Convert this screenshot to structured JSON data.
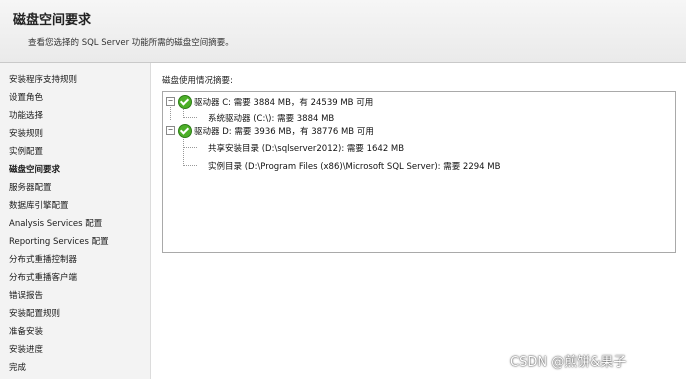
{
  "header": {
    "title": "磁盘空间要求",
    "subtitle": "查看您选择的 SQL Server 功能所需的磁盘空间摘要。"
  },
  "nav": {
    "items": [
      {
        "label": "安装程序支持规则"
      },
      {
        "label": "设置角色"
      },
      {
        "label": "功能选择"
      },
      {
        "label": "安装规则"
      },
      {
        "label": "实例配置"
      },
      {
        "label": "磁盘空间要求"
      },
      {
        "label": "服务器配置"
      },
      {
        "label": "数据库引擎配置"
      },
      {
        "label": "Analysis Services 配置"
      },
      {
        "label": "Reporting Services 配置"
      },
      {
        "label": "分布式重播控制器"
      },
      {
        "label": "分布式重播客户端"
      },
      {
        "label": "错误报告"
      },
      {
        "label": "安装配置规则"
      },
      {
        "label": "准备安装"
      },
      {
        "label": "安装进度"
      },
      {
        "label": "完成"
      }
    ]
  },
  "content": {
    "summary_label": "磁盘使用情况摘要:",
    "tree": {
      "drive_c": {
        "label": "驱动器 C: 需要 3884 MB，有 24539 MB 可用",
        "children": [
          "系统驱动器 (C:\\): 需要 3884 MB"
        ]
      },
      "drive_d": {
        "label": "驱动器 D: 需要 3936 MB，有 38776 MB 可用",
        "children": [
          "共享安装目录 (D:\\sqlserver2012): 需要 1642 MB",
          "实例目录 (D:\\Program Files (x86)\\Microsoft SQL Server): 需要 2294 MB"
        ]
      }
    }
  },
  "watermark": "CSDN @煎饼&果子"
}
